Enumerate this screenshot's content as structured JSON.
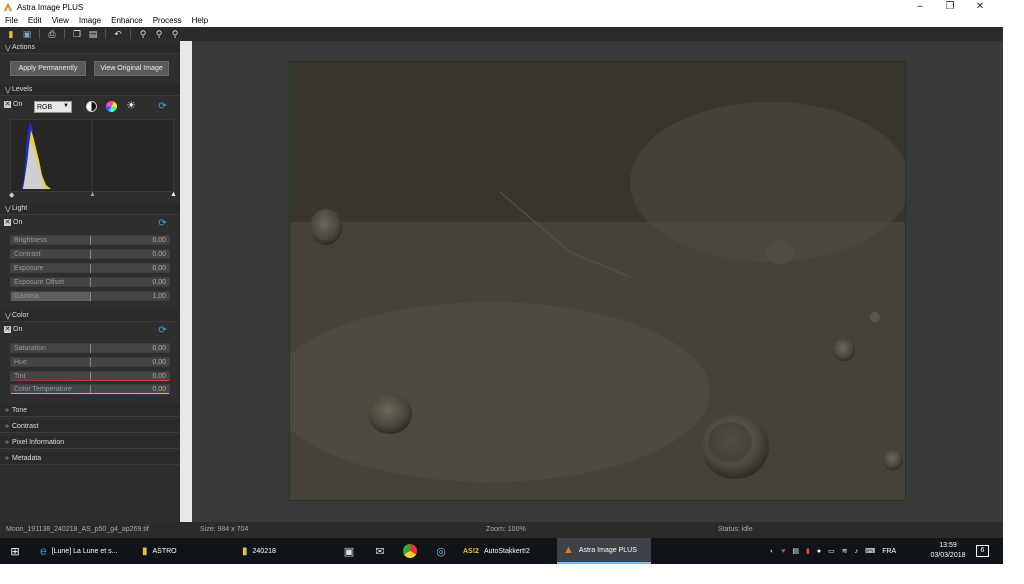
{
  "window": {
    "title": "Astra Image PLUS"
  },
  "menu": [
    "File",
    "Edit",
    "View",
    "Image",
    "Enhance",
    "Process",
    "Help"
  ],
  "actions": {
    "header": "Actions",
    "apply_label": "Apply Permanently",
    "view_original_label": "View Original Image"
  },
  "levels": {
    "header": "Levels",
    "on_label": "On",
    "channel": "RGB"
  },
  "light": {
    "header": "Light",
    "on_label": "On",
    "sliders": [
      {
        "label": "Brightness",
        "value": "0,00"
      },
      {
        "label": "Contrast",
        "value": "0,00"
      },
      {
        "label": "Exposure",
        "value": "0,00"
      },
      {
        "label": "Exposure Offset",
        "value": "0,00"
      },
      {
        "label": "Gamma",
        "value": "1,00"
      }
    ]
  },
  "color": {
    "header": "Color",
    "on_label": "On",
    "sliders": [
      {
        "label": "Saturation",
        "value": "0,00"
      },
      {
        "label": "Hue",
        "value": "0,00"
      },
      {
        "label": "Tint",
        "value": "0,00"
      },
      {
        "label": "Color Temperature",
        "value": "0,00"
      }
    ]
  },
  "collapsed_sections": [
    "Tone",
    "Contrast",
    "Pixel Information",
    "Metadata"
  ],
  "status": {
    "filename": "Moon_191138_240218_AS_p50_g4_ap269.tif",
    "size": "Size: 984 x 704",
    "zoom": "Zoom: 100%",
    "state": "Status: idle"
  },
  "taskbar": {
    "items": [
      "[Lune] La Lune et s...",
      "ASTRO",
      "240218",
      "AutoStakkert!2",
      "Astra Image PLUS"
    ],
    "language": "FRA",
    "time": "13:59",
    "date": "03/03/2018",
    "notification_count": "6"
  },
  "colors": {
    "accent": "#4aa3e0",
    "panel": "#2e2e2e",
    "taskbar": "#101317"
  }
}
